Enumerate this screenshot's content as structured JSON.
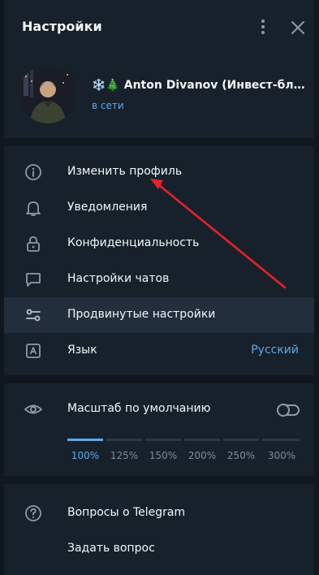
{
  "header": {
    "title": "Настройки"
  },
  "profile": {
    "emoji": "❄️🎄",
    "name": "Anton Divanov (Инвест-бл…",
    "status": "в сети"
  },
  "menu": [
    {
      "label": "Изменить профиль",
      "icon": "info-icon"
    },
    {
      "label": "Уведомления",
      "icon": "bell-icon"
    },
    {
      "label": "Конфиденциальность",
      "icon": "lock-icon"
    },
    {
      "label": "Настройки чатов",
      "icon": "chat-bubble-icon"
    },
    {
      "label": "Продвинутые настройки",
      "icon": "sliders-icon",
      "active": true
    },
    {
      "label": "Язык",
      "icon": "language-icon",
      "value": "Русский"
    }
  ],
  "scale": {
    "label": "Масштаб по умолчанию",
    "icon": "eye-icon",
    "toggle_on": false,
    "options": [
      "100%",
      "125%",
      "150%",
      "200%",
      "250%",
      "300%"
    ],
    "selected": "100%"
  },
  "help": [
    {
      "label": "Вопросы о Telegram",
      "icon": "question-icon"
    },
    {
      "label": "Задать вопрос"
    }
  ],
  "colors": {
    "panel_bg": "#17212b",
    "accent": "#5fa7e6",
    "annotation_arrow": "#e8202a"
  }
}
